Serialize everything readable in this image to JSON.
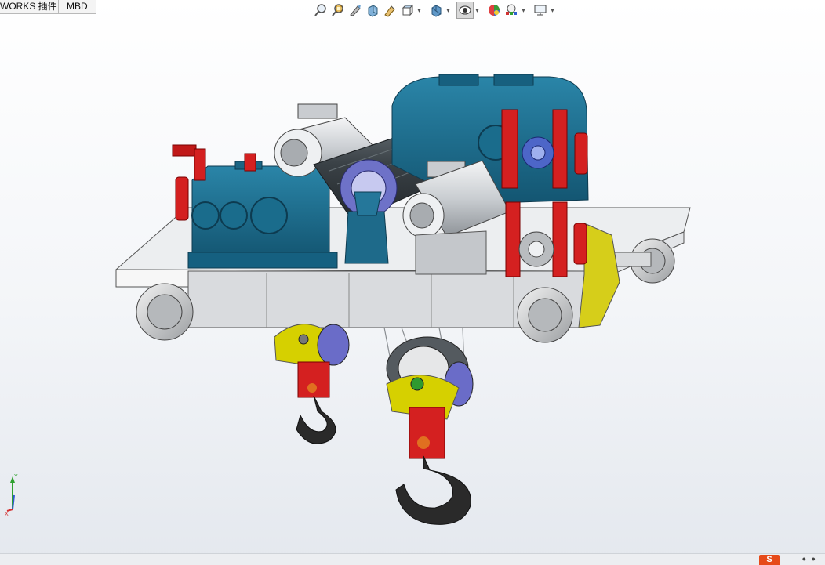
{
  "tabs": [
    {
      "label": "WORKS 插件"
    },
    {
      "label": "MBD"
    }
  ],
  "hud_toolbar": [
    {
      "icon": "zoom-to-fit-icon"
    },
    {
      "icon": "zoom-to-area-icon"
    },
    {
      "icon": "previous-view-icon"
    },
    {
      "icon": "section-view-icon"
    },
    {
      "icon": "dynamic-annotation-icon"
    },
    {
      "icon": "view-orientation-icon"
    },
    {
      "icon": "display-style-icon"
    },
    {
      "icon": "hide-show-items-icon"
    },
    {
      "icon": "edit-appearance-icon"
    },
    {
      "icon": "apply-scene-icon"
    },
    {
      "icon": "view-settings-icon"
    }
  ],
  "triad": {
    "y_label": "Y",
    "x_label": "X"
  },
  "colors": {
    "steel_blue": "#1f6f8f",
    "brake_red": "#d42020",
    "hook_yellow": "#d8d000",
    "frame_gray": "#cfd2d6",
    "motor_silver": "#e4e6e8",
    "hook_black": "#2a2a2a",
    "drum_dark": "#3c4247"
  },
  "status": {
    "logo": "S"
  }
}
